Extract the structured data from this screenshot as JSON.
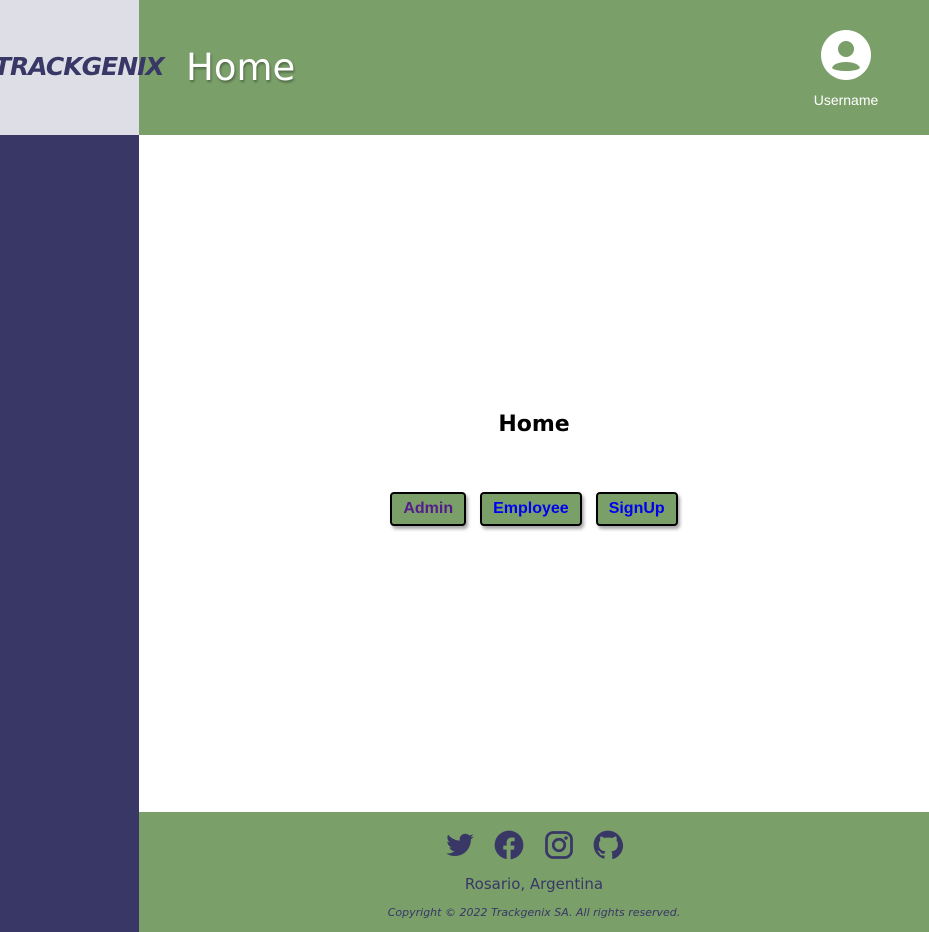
{
  "brand": {
    "logo_text": "TRACKGENIX"
  },
  "header": {
    "title": "Home",
    "username": "Username"
  },
  "main": {
    "title": "Home",
    "buttons": [
      {
        "label": "Admin",
        "state": "visited"
      },
      {
        "label": "Employee",
        "state": "link"
      },
      {
        "label": "SignUp",
        "state": "link"
      }
    ]
  },
  "footer": {
    "social_icons": [
      "twitter-icon",
      "facebook-icon",
      "instagram-icon",
      "github-icon"
    ],
    "location": "Rosario, Argentina",
    "copyright": "Copyright © 2022 Trackgenix SA. All rights reserved."
  },
  "colors": {
    "primary_green": "#7a9f69",
    "navy": "#383766",
    "logo_bg": "#dddee6",
    "link": "#0000ee",
    "visited": "#551a8b"
  }
}
